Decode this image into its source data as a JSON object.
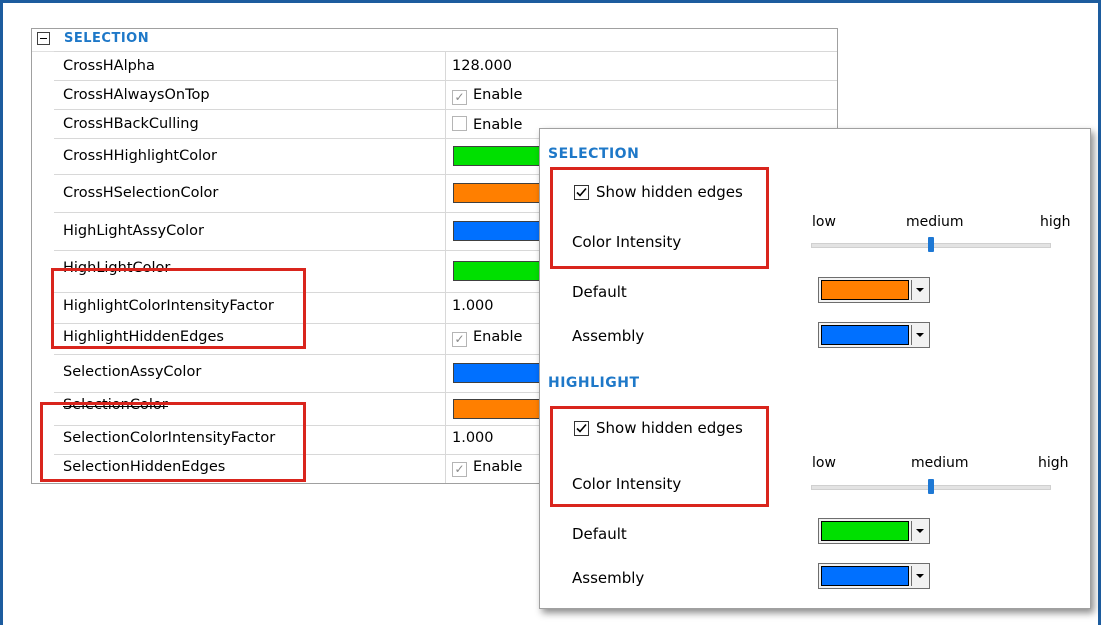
{
  "grid": {
    "category": "SELECTION",
    "rows": [
      {
        "name": "CrossHAlpha",
        "value": "128.000"
      },
      {
        "name": "CrossHAlwaysOnTop",
        "value": "Enable",
        "checked": true
      },
      {
        "name": "CrossHBackCulling",
        "value": "Enable",
        "checked": false
      },
      {
        "name": "CrossHHighlightColor",
        "color": "#00e000"
      },
      {
        "name": "CrossHSelectionColor",
        "color": "#ff7f00"
      },
      {
        "name": "HighLightAssyColor",
        "color": "#0070ff"
      },
      {
        "name": "HighLightColor",
        "color": "#00e000"
      },
      {
        "name": "HighlightColorIntensityFactor",
        "value": "1.000"
      },
      {
        "name": "HighlightHiddenEdges",
        "value": "Enable",
        "checked": true
      },
      {
        "name": "SelectionAssyColor",
        "color": "#0070ff"
      },
      {
        "name": "SelectionColor",
        "color": "#ff7f00"
      },
      {
        "name": "SelectionColorIntensityFactor",
        "value": "1.000"
      },
      {
        "name": "SelectionHiddenEdges",
        "value": "Enable",
        "checked": true
      }
    ]
  },
  "panel": {
    "selection": {
      "title": "SELECTION",
      "show_hidden_edges": "Show hidden edges",
      "show_hidden_edges_checked": true,
      "color_intensity": "Color Intensity",
      "slider_low": "low",
      "slider_medium": "medium",
      "slider_high": "high",
      "slider_value": 0.5,
      "default_label": "Default",
      "default_color": "#ff7f00",
      "assembly_label": "Assembly",
      "assembly_color": "#0070ff"
    },
    "highlight": {
      "title": "HIGHLIGHT",
      "show_hidden_edges": "Show hidden edges",
      "show_hidden_edges_checked": true,
      "color_intensity": "Color Intensity",
      "slider_low": "low",
      "slider_medium": "medium",
      "slider_high": "high",
      "slider_value": 0.5,
      "default_label": "Default",
      "default_color": "#00e000",
      "assembly_label": "Assembly",
      "assembly_color": "#0070ff"
    }
  },
  "colors": {
    "frame": "#1d5c9e",
    "section_title": "#1e78c8",
    "highlight_box": "#d9251d"
  }
}
